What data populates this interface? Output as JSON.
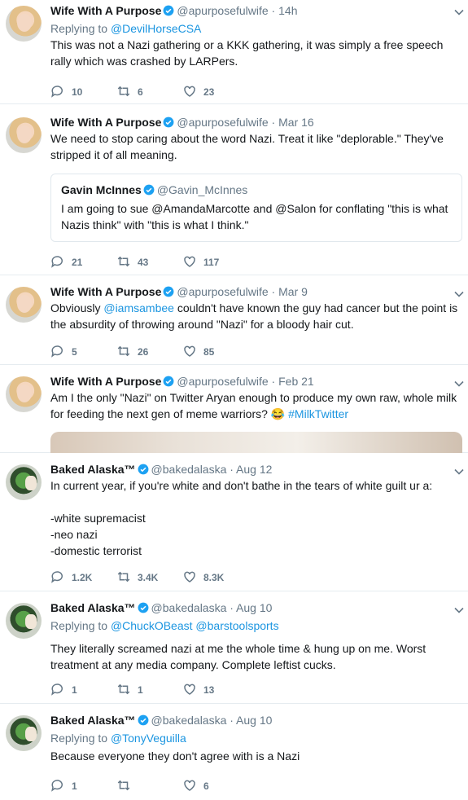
{
  "tweets": [
    {
      "name": "Wife With A Purpose",
      "handle": "@apurposefulwife",
      "time": "14h",
      "reply_prefix": "Replying to ",
      "reply_to": "@DevilHorseCSA",
      "text": "This was not a Nazi gathering or a KKK gathering, it was simply a free speech rally which was crashed by LARPers.",
      "replies": "10",
      "retweets": "6",
      "likes": "23"
    },
    {
      "name": "Wife With A Purpose",
      "handle": "@apurposefulwife",
      "time": "Mar 16",
      "text": "We need to stop caring about the word Nazi. Treat it like \"deplorable.\" They've stripped it of all meaning.",
      "quote": {
        "name": "Gavin McInnes",
        "handle": "@Gavin_McInnes",
        "text": "I am going to sue @AmandaMarcotte and @Salon for conflating \"this is what Nazis think\" with \"this is what I think.\""
      },
      "replies": "21",
      "retweets": "43",
      "likes": "117"
    },
    {
      "name": "Wife With A Purpose",
      "handle": "@apurposefulwife",
      "time": "Mar 9",
      "text_before": "Obviously ",
      "mention": "@iamsambee",
      "text_after": " couldn't have known the guy had cancer but the point is the absurdity of throwing around \"Nazi\" for a bloody hair cut.",
      "replies": "5",
      "retweets": "26",
      "likes": "85"
    },
    {
      "name": "Wife With A Purpose",
      "handle": "@apurposefulwife",
      "time": "Feb 21",
      "text": "Am I the only \"Nazi\" on Twitter Aryan enough to produce my own raw, whole milk for feeding the next gen of meme warriors? 😂 ",
      "hashtag": "#MilkTwitter"
    },
    {
      "name": "Baked Alaska™",
      "handle": "@bakedalaska",
      "time": "Aug 12",
      "text": "In current year, if you're white and don't bathe in the tears of white guilt ur a:\n\n-white supremacist\n-neo nazi\n-domestic terrorist",
      "replies": "1.2K",
      "retweets": "3.4K",
      "likes": "8.3K"
    },
    {
      "name": "Baked Alaska™",
      "handle": "@bakedalaska",
      "time": "Aug 10",
      "reply_prefix": "Replying to ",
      "reply_to": "@ChuckOBeast",
      "reply_to_2": "@barstoolsports",
      "text": "They literally screamed nazi at me the whole time & hung up on me. Worst treatment at any media company. Complete leftist cucks.",
      "replies": "1",
      "retweets": "1",
      "likes": "13"
    },
    {
      "name": "Baked Alaska™",
      "handle": "@bakedalaska",
      "time": "Aug 10",
      "reply_prefix": "Replying to ",
      "reply_to": "@TonyVeguilla",
      "text": "Because everyone they don't agree with is a Nazi",
      "replies": "1",
      "retweets": "",
      "likes": "6"
    }
  ],
  "separator": " · ",
  "colors": {
    "link": "#1b95e0",
    "muted": "#657786",
    "verified": "#1da1f2"
  }
}
